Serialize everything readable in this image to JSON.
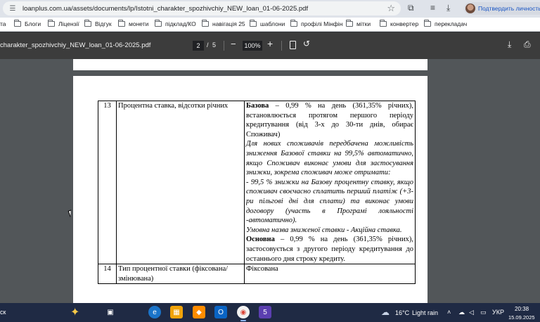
{
  "browser": {
    "url": "loanplus.com.ua/assets/documents/lp/Istotni_charakter_spozhivchiy_NEW_loan_01-06-2025.pdf",
    "profile_label": "Подтвердить личность",
    "bookmarks": [
      "та",
      "Блоги",
      "Ліцензії",
      "Відгук",
      "монети",
      "підклад/КО",
      "навігація 25",
      "шаблони",
      "профілі Мінфін",
      "мітки",
      "конвертер",
      "перекладач"
    ]
  },
  "pdf_toolbar": {
    "title": "charakter_spozhivchiy_NEW_loan_01-06-2025.pdf",
    "page_current": "2",
    "page_separator": "/",
    "page_total": "5",
    "zoom": "100%"
  },
  "document": {
    "row13": {
      "num": "13",
      "name": "Процентна ставка, відсотки річних",
      "base_label": "Базова",
      "base_text": " – 0,99 % на день (361,35% річних), встановлюється протягом першого періоду кредитування (від 3-х до 30-ти днів, обирає Споживач)",
      "discount_intro": "Для нових споживачів передбачена можливість зниження Базової ставки на 99,5% автоматично, якщо Споживач виконає умови для застосування знижки, зокрема споживач може отримати:",
      "discount_item": "-      99,5 % знижки на Базову процентну ставку, якщо споживач своєчасно сплатить перший платіж (+3-ри пільгові дні для сплати) та виконає умови договору (участь в Програмі лояльності -автоматично).",
      "conditional_name": "Умовна назва зниженої ставки -   Акційна ставка.",
      "main_label": "Основна",
      "main_text": " – 0,99 % на день (361,35% річних), застосовується з другого періоду кредитування до останнього дня строку кредиту."
    },
    "row14": {
      "num": "14",
      "name": "Тип процентної ставки (фіксована/змінювана)",
      "value": "Фіксована"
    }
  },
  "taskbar": {
    "search_text": "ск",
    "weather_temp": "16°C",
    "weather_desc": "Light rain",
    "language": "УКР",
    "time": "20:38",
    "date": "15.09.2025"
  },
  "colors": {
    "viewer_bg": "#525659",
    "toolbar_bg": "#3c3c3c",
    "addressbar_bg": "#dfe3ea",
    "taskbar_bg": "#1f2a44",
    "profile_link": "#1a56c4"
  }
}
